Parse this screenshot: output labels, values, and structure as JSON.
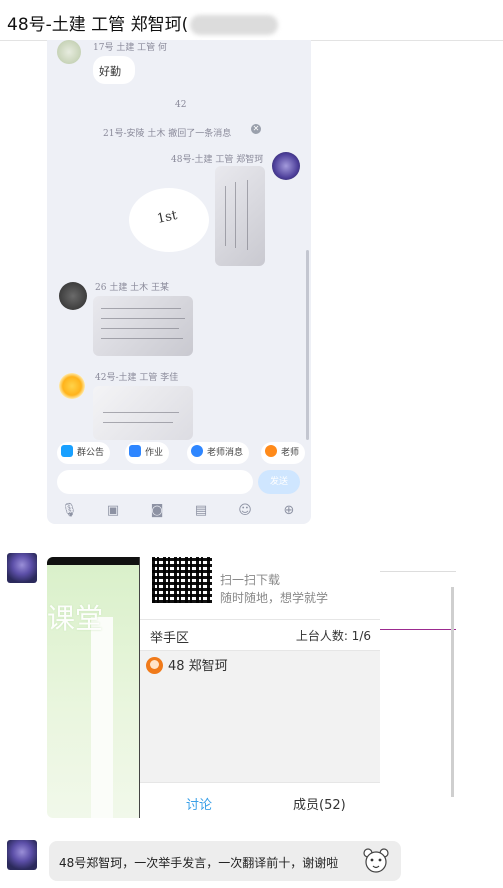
{
  "window": {
    "title": "48号-土建 工管 郑智珂("
  },
  "phone": {
    "top_user": "17号 土建 工管 何",
    "top_message": "好勤",
    "recall_num": "42",
    "recall_notice": "21号-安陵 土木 撤回了一条消息",
    "sender1_name": "48号-土建 工管 郑智珂",
    "sticker_text": "1st",
    "sender2_name": "26 土建 土木 王某",
    "sender3_name": "42号-土建 工管 李佳",
    "chips": [
      "群公告",
      "作业",
      "老师消息",
      "老师"
    ],
    "send_label": "发送",
    "toolbar_icons": [
      "microphone-icon",
      "image-icon",
      "camera-icon",
      "archive-icon",
      "emoji-icon",
      "plus-icon"
    ]
  },
  "classroom": {
    "left_text": "课堂",
    "scan_line1": "扫一扫下载",
    "scan_line2": "随时随地，想学就学",
    "raise_hand_title": "举手区",
    "stage_count": "上台人数: 1/6",
    "member_name": "48 郑智珂",
    "tab_discuss": "讨论",
    "tab_members": "成员(52)"
  },
  "message3": {
    "text": "48号郑智珂，一次举手发言，一次翻译前十，谢谢啦"
  },
  "colors": {
    "accent_blue": "#3aa0e8",
    "purple_line": "#9b2a8f",
    "chip_icon": "#2e86ff"
  }
}
